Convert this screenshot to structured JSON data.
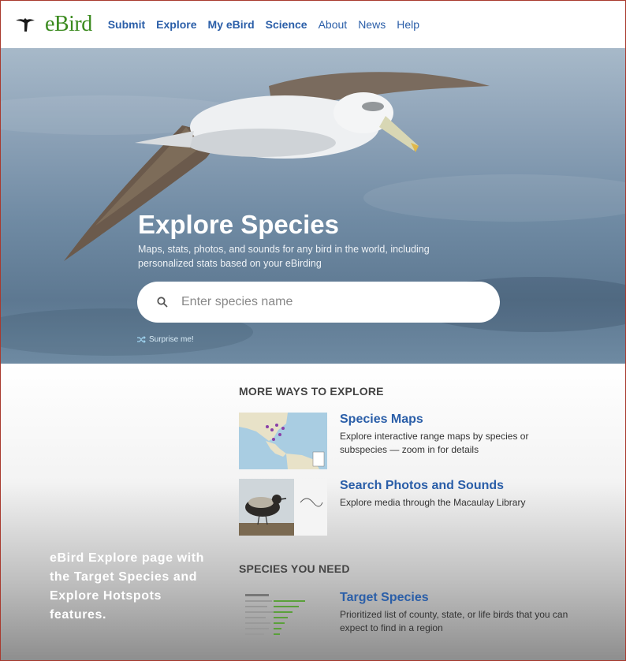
{
  "header": {
    "logo_text": "eBird",
    "logo_icon": "ebird-bird-icon",
    "nav": [
      {
        "label": "Submit",
        "bold": true
      },
      {
        "label": "Explore",
        "bold": true
      },
      {
        "label": "My eBird",
        "bold": true
      },
      {
        "label": "Science",
        "bold": true
      },
      {
        "label": "About",
        "bold": false
      },
      {
        "label": "News",
        "bold": false
      },
      {
        "label": "Help",
        "bold": false
      }
    ]
  },
  "hero": {
    "title": "Explore Species",
    "subtitle": "Maps, stats, photos, and sounds for any bird in the world, including personalized stats based on your eBirding",
    "search_placeholder": "Enter species name",
    "surprise_label": "Surprise me!"
  },
  "more_ways": {
    "heading": "MORE WAYS TO EXPLORE",
    "cards": [
      {
        "title": "Species Maps",
        "description": "Explore interactive range maps by species or subspecies — zoom in for details"
      },
      {
        "title": "Search Photos and Sounds",
        "description": "Explore media through the Macaulay Library"
      }
    ]
  },
  "species_you_need": {
    "heading": "SPECIES YOU NEED",
    "cards": [
      {
        "title": "Target Species",
        "description": "Prioritized list of county, state, or life birds that you can expect to find in a region"
      }
    ]
  },
  "caption": "eBird Explore page with the Target Species and Explore Hotspots features.",
  "colors": {
    "link_blue": "#2a5ea8",
    "brand_green": "#3a8a1e",
    "frame_border": "#a83a2e"
  }
}
